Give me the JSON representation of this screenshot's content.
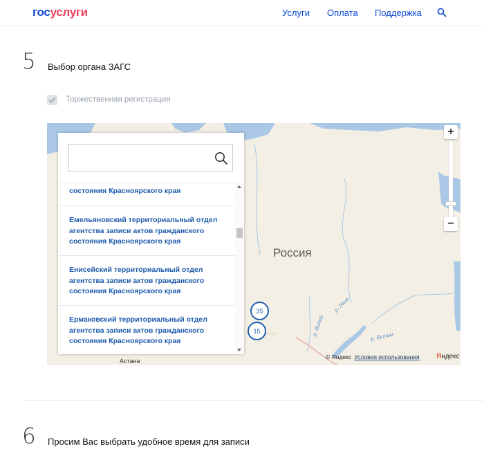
{
  "header": {
    "logo_part1": "гос",
    "logo_part2": "услуги",
    "nav": [
      {
        "label": "Услуги"
      },
      {
        "label": "Оплата"
      },
      {
        "label": "Поддержка"
      }
    ],
    "search_icon": "search-icon"
  },
  "colors": {
    "brand_blue": "#0d4cd3",
    "brand_red": "#ee3f58",
    "link_blue": "#1d5bac"
  },
  "step5": {
    "number": "5",
    "title": "Выбор органа ЗАГС",
    "checkbox": {
      "label": "Торжественная регистрация",
      "checked": true,
      "disabled": true
    }
  },
  "organ_search": {
    "placeholder": "",
    "value": ""
  },
  "organ_list": [
    {
      "line1": "состояния Красноярского края",
      "line2": "",
      "line3": ""
    },
    {
      "line1": "Емельяновский территориальный отдел",
      "line2": "агентства записи актов гражданского",
      "line3": "состояния Красноярского края"
    },
    {
      "line1": "Енисейский территориальный отдел",
      "line2": "агентства записи актов гражданского",
      "line3": "состояния Красноярского края"
    },
    {
      "line1": "Ермаковский территориальный отдел",
      "line2": "агентства записи актов гражданского",
      "line3": "состояния Красноярского края"
    }
  ],
  "map": {
    "country_label": "Россия",
    "city_label": "Астана",
    "rivers": [
      "р. Лена",
      "р. Витим",
      "р. Вилюй"
    ],
    "clusters": [
      {
        "count": "35"
      },
      {
        "count": "15"
      }
    ],
    "zoom_in": "+",
    "zoom_out": "−",
    "copyright": "© Яндекс",
    "terms": "Условия использования",
    "logo_y": "Я",
    "logo_rest": "ндекс"
  },
  "step6": {
    "number": "6",
    "title": "Просим Вас выбрать удобное время для записи"
  }
}
